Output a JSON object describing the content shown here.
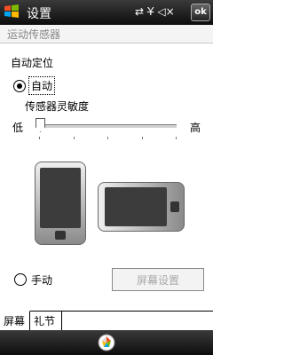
{
  "titlebar": {
    "title": "设置",
    "ok_label": "ok",
    "status_icons": [
      "sync-arrows-icon",
      "no-signal-icon",
      "speaker-icon"
    ]
  },
  "subheader": {
    "title": "运动传感器"
  },
  "auto_rotate": {
    "section_label": "自动定位",
    "auto_option_label": "自动",
    "auto_selected": true,
    "sensitivity_label": "传感器灵敏度",
    "low_label": "低",
    "high_label": "高",
    "sensitivity_level": 0
  },
  "manual": {
    "option_label": "手动",
    "selected": false,
    "screen_settings_label": "屏幕设置"
  },
  "tabs": [
    {
      "label": "屏幕",
      "active": true
    },
    {
      "label": "礼节",
      "active": false
    }
  ],
  "colors": {
    "titlebar": "#1a1a1a",
    "disabled_text": "#a8a8a8"
  }
}
